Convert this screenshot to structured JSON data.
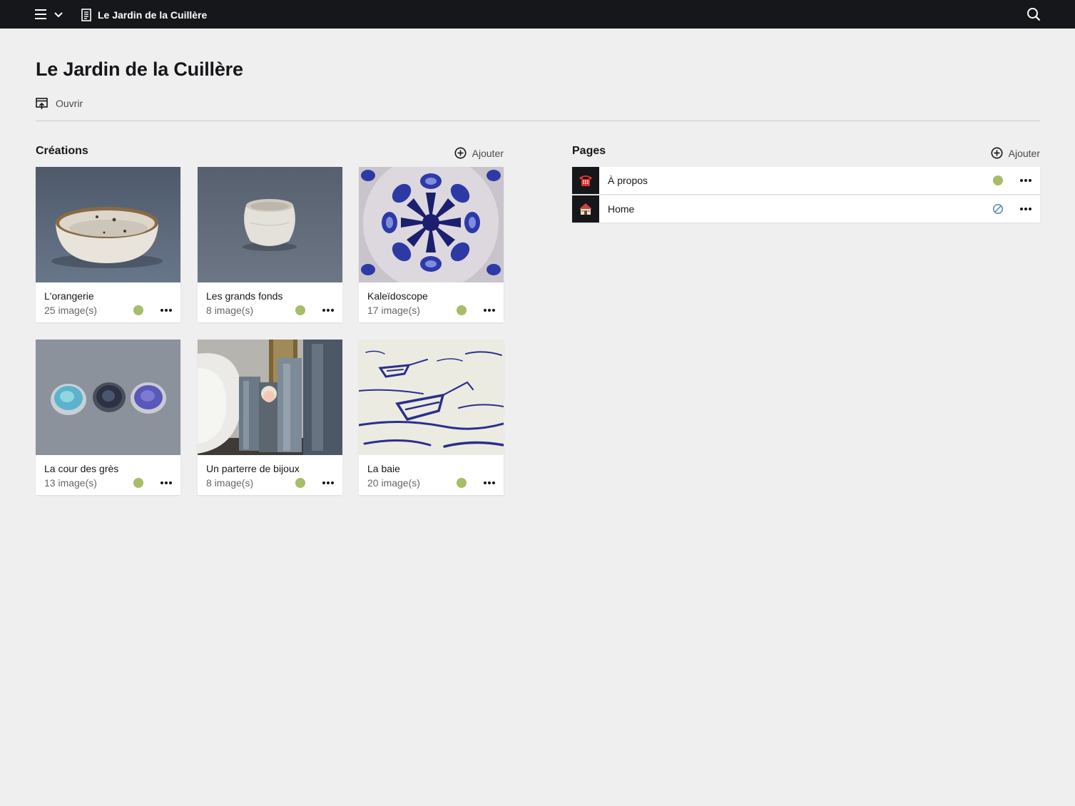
{
  "topbar": {
    "menu_icon": "hamburger-menu-icon",
    "chevron_icon": "chevron-down-icon",
    "site_icon": "document-icon",
    "site_label": "Le Jardin de la Cuillère",
    "search_icon": "search-icon",
    "background": "#16171a"
  },
  "header": {
    "title": "Le Jardin de la Cuillère",
    "open_label": "Ouvrir",
    "open_icon": "open-in-browser-icon"
  },
  "creations": {
    "title": "Créations",
    "add_label": "Ajouter",
    "add_icon": "add-circle-icon",
    "items": [
      {
        "title": "L'orangerie",
        "count": "25 image(s)",
        "status": "published"
      },
      {
        "title": "Les grands fonds",
        "count": "8 image(s)",
        "status": "published"
      },
      {
        "title": "Kaleïdoscope",
        "count": "17 image(s)",
        "status": "published"
      },
      {
        "title": "La cour des grès",
        "count": "13 image(s)",
        "status": "published"
      },
      {
        "title": "Un parterre de bijoux",
        "count": "8 image(s)",
        "status": "published"
      },
      {
        "title": "La baie",
        "count": "20 image(s)",
        "status": "published"
      }
    ]
  },
  "pages": {
    "title": "Pages",
    "add_label": "Ajouter",
    "add_icon": "add-circle-icon",
    "items": [
      {
        "label": "À propos",
        "icon": "telephone-icon",
        "status": "published"
      },
      {
        "label": "Home",
        "icon": "house-icon",
        "status": "draft"
      }
    ]
  },
  "colors": {
    "published": "#a7bd68",
    "draft": "#5a8bb0",
    "background": "#efefef"
  }
}
